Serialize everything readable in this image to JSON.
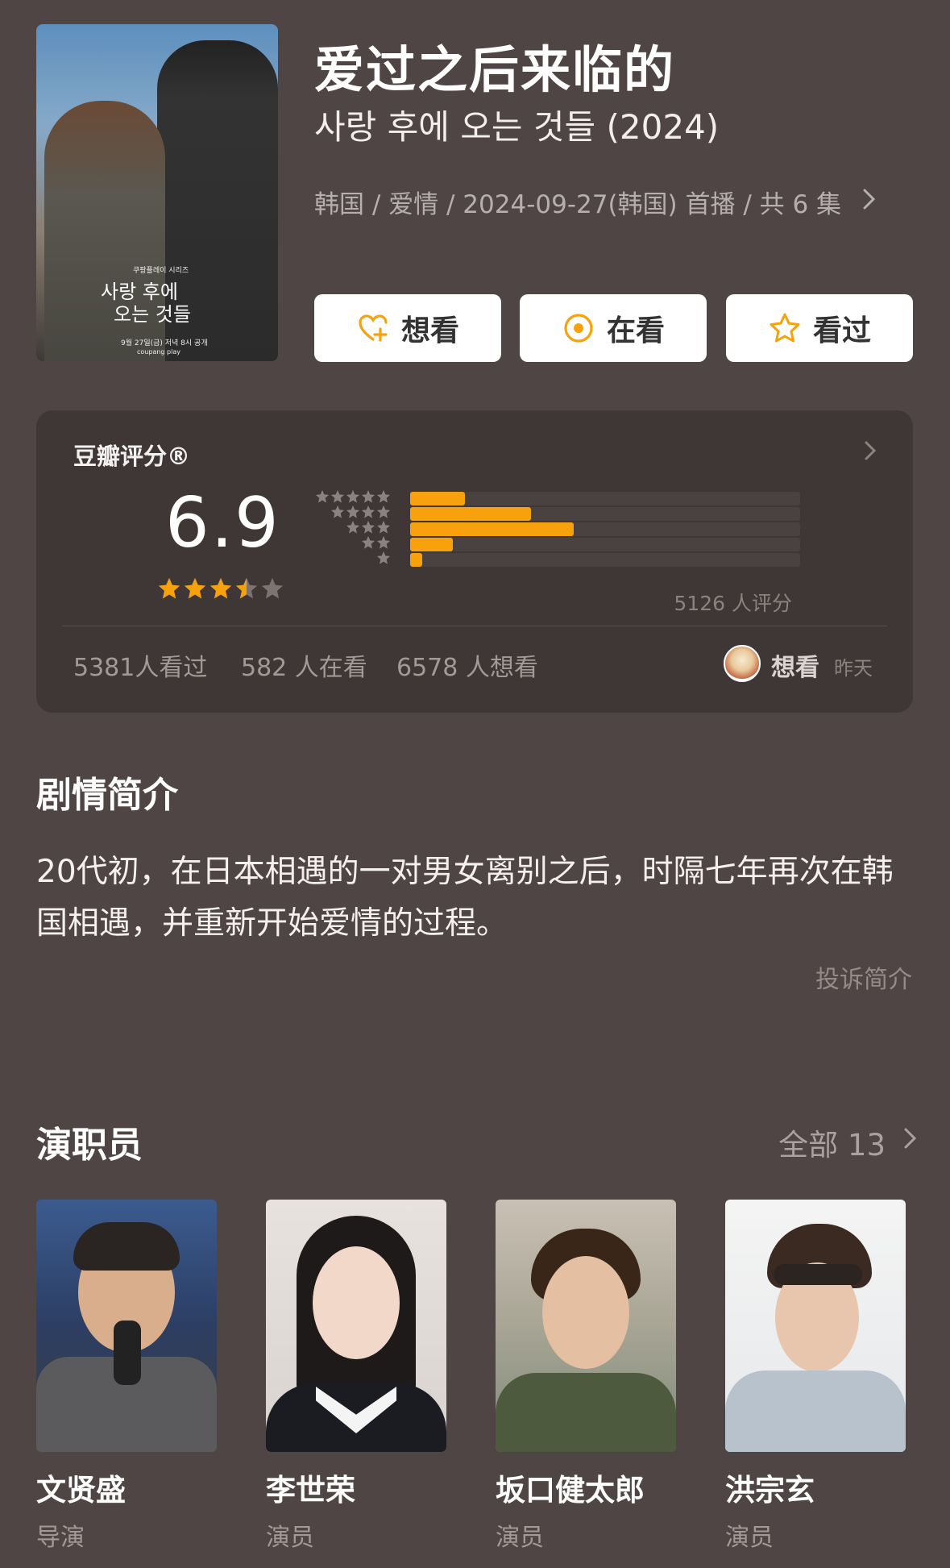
{
  "header": {
    "poster": {
      "small_text": "쿠팡플레이 시리즈",
      "title_line1": "사랑 후에",
      "title_line2": "오는 것들",
      "date": "9월 27일(금) 저녁 8시 공개",
      "logo": "coupang play"
    },
    "title": "爱过之后来临的",
    "subtitle": "사랑 후에 오는 것들 (2024)",
    "meta": "韩国 / 爱情 / 2024-09-27(韩国) 首播 / 共 6 集",
    "actions": [
      {
        "label": "想看",
        "icon": "heart-plus-icon"
      },
      {
        "label": "在看",
        "icon": "target-circle-icon"
      },
      {
        "label": "看过",
        "icon": "star-outline-icon"
      }
    ]
  },
  "rating": {
    "label": "豆瓣评分®",
    "score": "6.9",
    "stars": 3.5,
    "distribution": [
      {
        "stars": 5,
        "fraction": 0.14
      },
      {
        "stars": 4,
        "fraction": 0.31
      },
      {
        "stars": 3,
        "fraction": 0.42
      },
      {
        "stars": 2,
        "fraction": 0.11
      },
      {
        "stars": 1,
        "fraction": 0.03
      }
    ],
    "count": "5126 人评分",
    "watched": "5381人看过",
    "watching": "582 人在看",
    "want": "6578 人想看",
    "activity": "想看",
    "activity_time": "昨天"
  },
  "synopsis": {
    "title": "剧情简介",
    "text": "20代初，在日本相遇的一对男女离别之后，时隔七年再次在韩国相遇，并重新开始爱情的过程。",
    "report": "投诉简介"
  },
  "cast": {
    "title": "演职员",
    "all": "全部 13",
    "members": [
      {
        "name": "文贤盛",
        "role": "导演"
      },
      {
        "name": "李世荣",
        "role": "演员"
      },
      {
        "name": "坂口健太郎",
        "role": "演员"
      },
      {
        "name": "洪宗玄",
        "role": "演员"
      }
    ]
  },
  "colors": {
    "background": "#4f4544",
    "card": "#3f3735",
    "accent": "#f7a20d"
  }
}
